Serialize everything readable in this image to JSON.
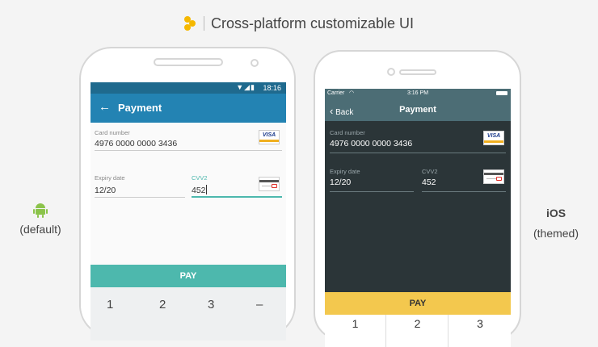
{
  "header": {
    "title": "Cross-platform customizable UI",
    "logo_icon": "honeycomb-logo-icon",
    "logo_color": "#f5b800"
  },
  "android_label": {
    "icon": "android-robot-icon",
    "name": "(default)",
    "icon_color": "#8bc34a"
  },
  "ios_label": {
    "name": "iOS",
    "subtitle": "(themed)"
  },
  "android": {
    "status": {
      "time": "18:16"
    },
    "toolbar": {
      "title": "Payment",
      "back_icon": "back-arrow-icon"
    },
    "card_number": {
      "label": "Card number",
      "value": "4976 0000 0000 3436",
      "brand": "VISA"
    },
    "expiry": {
      "label": "Expiry date",
      "value": "12/20"
    },
    "cvv": {
      "label": "CVV2",
      "value": "452"
    },
    "pay_label": "PAY",
    "keys": [
      "1",
      "2",
      "3",
      "–"
    ],
    "colors": {
      "status": "#1f6a8e",
      "toolbar": "#2383b3",
      "pay": "#4db8ad",
      "focus": "#4db8ad"
    }
  },
  "ios": {
    "status": {
      "carrier": "Carrier",
      "time": "3:16 PM"
    },
    "nav": {
      "back_label": "Back",
      "title": "Payment"
    },
    "card_number": {
      "label": "Card number",
      "value": "4976 0000 0000 3436",
      "brand": "VISA"
    },
    "expiry": {
      "label": "Expiry date",
      "value": "12/20"
    },
    "cvv": {
      "label": "CVV2",
      "value": "452"
    },
    "pay_label": "PAY",
    "keys": [
      "1",
      "2",
      "3"
    ],
    "colors": {
      "nav": "#4c6d75",
      "background": "#2b3538",
      "pay": "#f3c84e"
    }
  }
}
